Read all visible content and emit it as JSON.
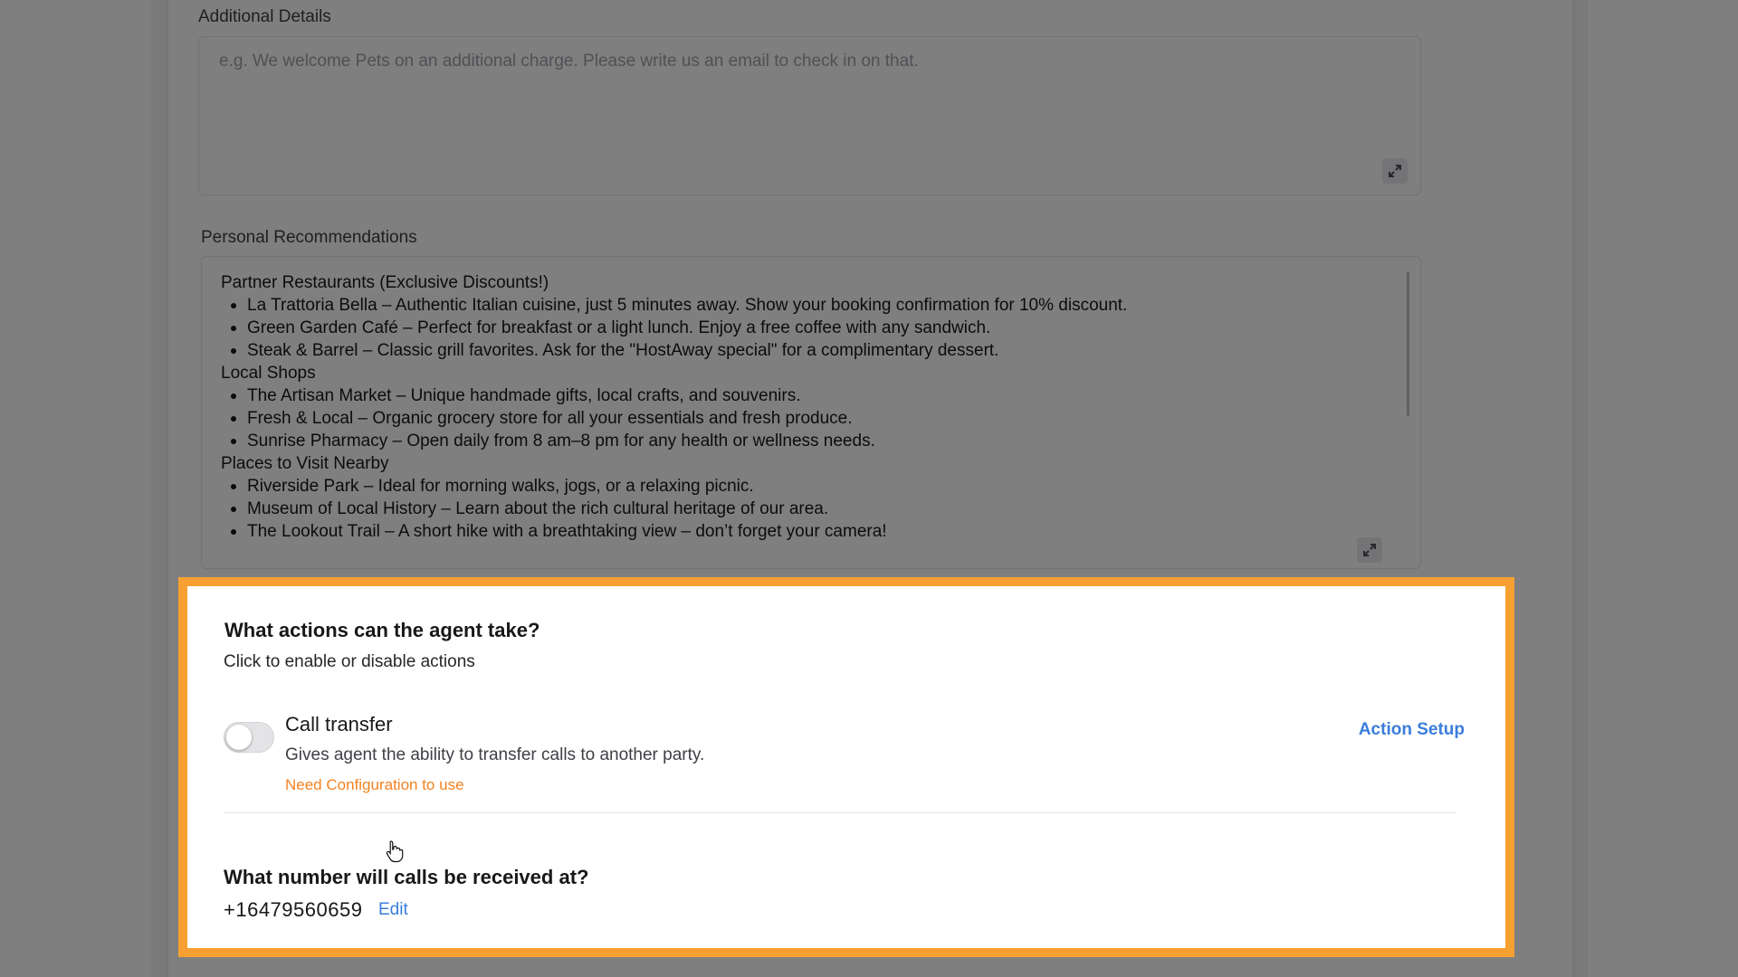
{
  "additional_details": {
    "label": "Additional Details",
    "placeholder": "e.g. We welcome Pets on an additional charge. Please write us an email to check in on that.",
    "value": ""
  },
  "personal_recommendations": {
    "label": "Personal Recommendations",
    "sections": [
      {
        "heading": "Partner Restaurants (Exclusive Discounts!)",
        "items": [
          "La Trattoria Bella – Authentic Italian cuisine, just 5 minutes away. Show your booking confirmation for 10% discount.",
          "Green Garden Café – Perfect for breakfast or a light lunch. Enjoy a free coffee with any sandwich.",
          "Steak & Barrel – Classic grill favorites. Ask for the \"HostAway special\" for a complimentary dessert."
        ]
      },
      {
        "heading": "Local Shops",
        "items": [
          "The Artisan Market – Unique handmade gifts, local crafts, and souvenirs.",
          "Fresh & Local – Organic grocery store for all your essentials and fresh produce.",
          "Sunrise Pharmacy – Open daily from 8 am–8 pm for any health or wellness needs."
        ]
      },
      {
        "heading": "Places to Visit Nearby",
        "items": [
          "Riverside Park – Ideal for morning walks, jogs, or a relaxing picnic.",
          "Museum of Local History – Learn about the rich cultural heritage of our area.",
          "The Lookout Trail – A short hike with a breathtaking view – don’t forget your camera!"
        ]
      }
    ]
  },
  "actions": {
    "title": "What actions can the agent take?",
    "subtitle": "Click to enable or disable actions",
    "items": [
      {
        "name": "Call transfer",
        "description": "Gives agent the ability to transfer calls to another party.",
        "warning": "Need Configuration to use",
        "setup_label": "Action Setup",
        "enabled": false
      }
    ]
  },
  "phone": {
    "question": "What number will calls be received at?",
    "number": "+16479560659",
    "edit_label": "Edit"
  },
  "colors": {
    "highlight_border": "#f7a032",
    "link": "#3b7ddd",
    "warning": "#f58220"
  }
}
